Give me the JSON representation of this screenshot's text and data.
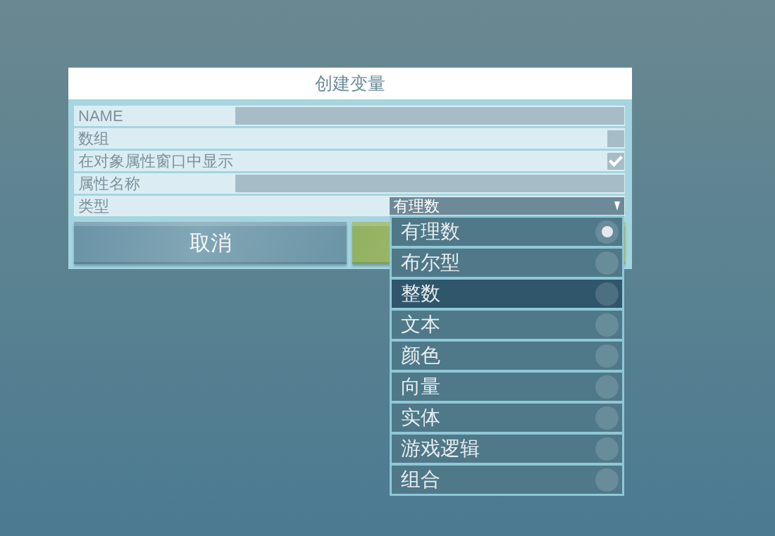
{
  "dialog": {
    "title": "创建变量",
    "fields": [
      {
        "kind": "text",
        "label": "NAME"
      },
      {
        "kind": "checkbox",
        "label": "数组",
        "checked": false
      },
      {
        "kind": "checkbox",
        "label": "在对象属性窗口中显示",
        "checked": true
      },
      {
        "kind": "text",
        "label": "属性名称"
      },
      {
        "kind": "dropdown",
        "label": "类型",
        "value": "有理数",
        "expanded": true,
        "options": [
          {
            "label": "有理数",
            "selected": true,
            "highlighted": false
          },
          {
            "label": "布尔型",
            "selected": false,
            "highlighted": false
          },
          {
            "label": "整数",
            "selected": false,
            "highlighted": true
          },
          {
            "label": "文本",
            "selected": false,
            "highlighted": false
          },
          {
            "label": "颜色",
            "selected": false,
            "highlighted": false
          },
          {
            "label": "向量",
            "selected": false,
            "highlighted": false
          },
          {
            "label": "实体",
            "selected": false,
            "highlighted": false
          },
          {
            "label": "游戏逻辑",
            "selected": false,
            "highlighted": false
          },
          {
            "label": "组合",
            "selected": false,
            "highlighted": false
          }
        ]
      }
    ],
    "buttons": [
      {
        "kind": "cancel",
        "label": "取消"
      },
      {
        "kind": "confirm"
      }
    ]
  }
}
